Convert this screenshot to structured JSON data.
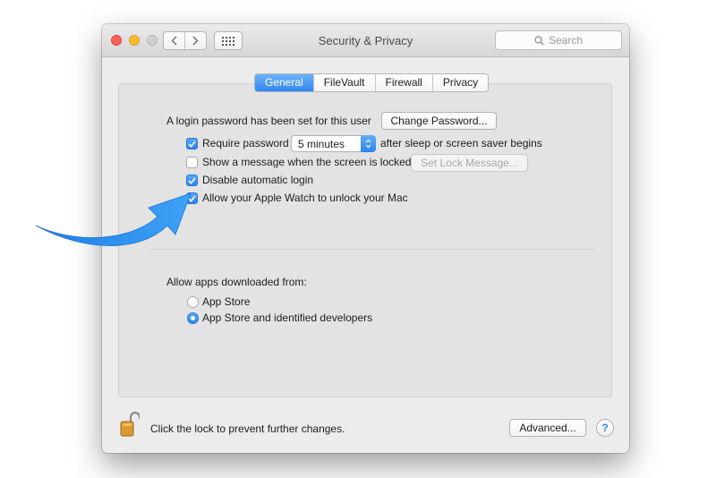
{
  "window": {
    "title": "Security & Privacy"
  },
  "search": {
    "placeholder": "Search"
  },
  "tabs": [
    {
      "label": "General",
      "active": true
    },
    {
      "label": "FileVault",
      "active": false
    },
    {
      "label": "Firewall",
      "active": false
    },
    {
      "label": "Privacy",
      "active": false
    }
  ],
  "general": {
    "login_password_text": "A login password has been set for this user",
    "change_password_button": "Change Password...",
    "require_password": {
      "label": "Require password",
      "checked": true,
      "delay_value": "5 minutes",
      "suffix": "after sleep or screen saver begins"
    },
    "show_message": {
      "label": "Show a message when the screen is locked",
      "checked": false,
      "button": "Set Lock Message..."
    },
    "disable_auto_login": {
      "label": "Disable automatic login",
      "checked": true
    },
    "apple_watch_unlock": {
      "label": "Allow your Apple Watch to unlock your Mac",
      "checked": true
    },
    "allow_apps_heading": "Allow apps downloaded from:",
    "allow_apps_options": [
      {
        "label": "App Store",
        "selected": false
      },
      {
        "label": "App Store and identified developers",
        "selected": true
      }
    ]
  },
  "footer": {
    "lock_text": "Click the lock to prevent further changes.",
    "advanced_button": "Advanced...",
    "help_button": "?"
  },
  "colors": {
    "accent": "#2f86f2",
    "arrow": "#2b8ff0"
  },
  "icons": [
    "back-chevron-icon",
    "forward-chevron-icon",
    "grid-icon",
    "search-icon",
    "padlock-icon",
    "arrow-icon"
  ]
}
